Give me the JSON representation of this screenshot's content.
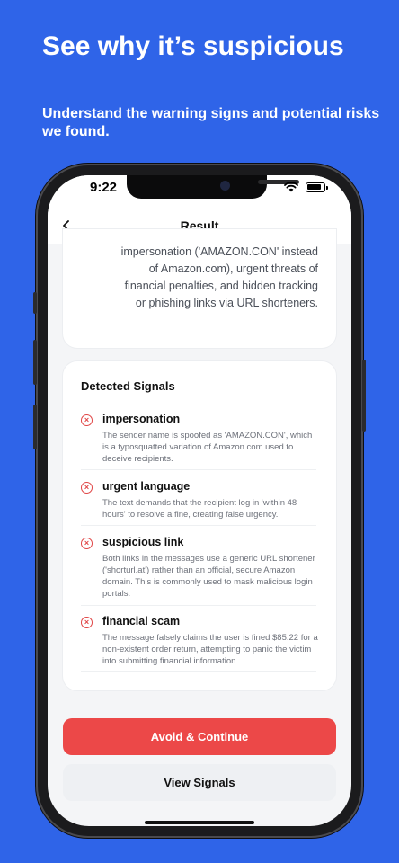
{
  "promo": {
    "headline": "See why it’s suspicious",
    "subline": "Understand the warning signs and potential risks we found."
  },
  "status_bar": {
    "time": "9:22"
  },
  "nav": {
    "title": "Result",
    "back_icon": "chevron-left-icon"
  },
  "summary": {
    "text": "impersonation ('AMAZON.CON' instead of Amazon.com), urgent threats of financial penalties, and hidden tracking or phishing links via URL shorteners."
  },
  "signals": {
    "title": "Detected Signals",
    "items": [
      {
        "name": "impersonation",
        "description": "The sender name is spoofed as 'AMAZON.CON', which is a typosquatted variation of Amazon.com used to deceive recipients."
      },
      {
        "name": "urgent language",
        "description": "The text demands that the recipient log in 'within 48 hours' to resolve a fine, creating false urgency."
      },
      {
        "name": "suspicious link",
        "description": "Both links in the messages use a generic URL shortener ('shorturl.at') rather than an official, secure Amazon domain. This is commonly used to mask malicious login portals."
      },
      {
        "name": "financial scam",
        "description": "The message falsely claims the user is fined $85.22 for a non-existent order return, attempting to panic the victim into submitting financial information."
      }
    ]
  },
  "actions": {
    "primary_label": "Avoid & Continue",
    "secondary_label": "View Signals"
  },
  "colors": {
    "background": "#2f64e8",
    "danger": "#ec4848",
    "signal_icon": "#e04646"
  }
}
